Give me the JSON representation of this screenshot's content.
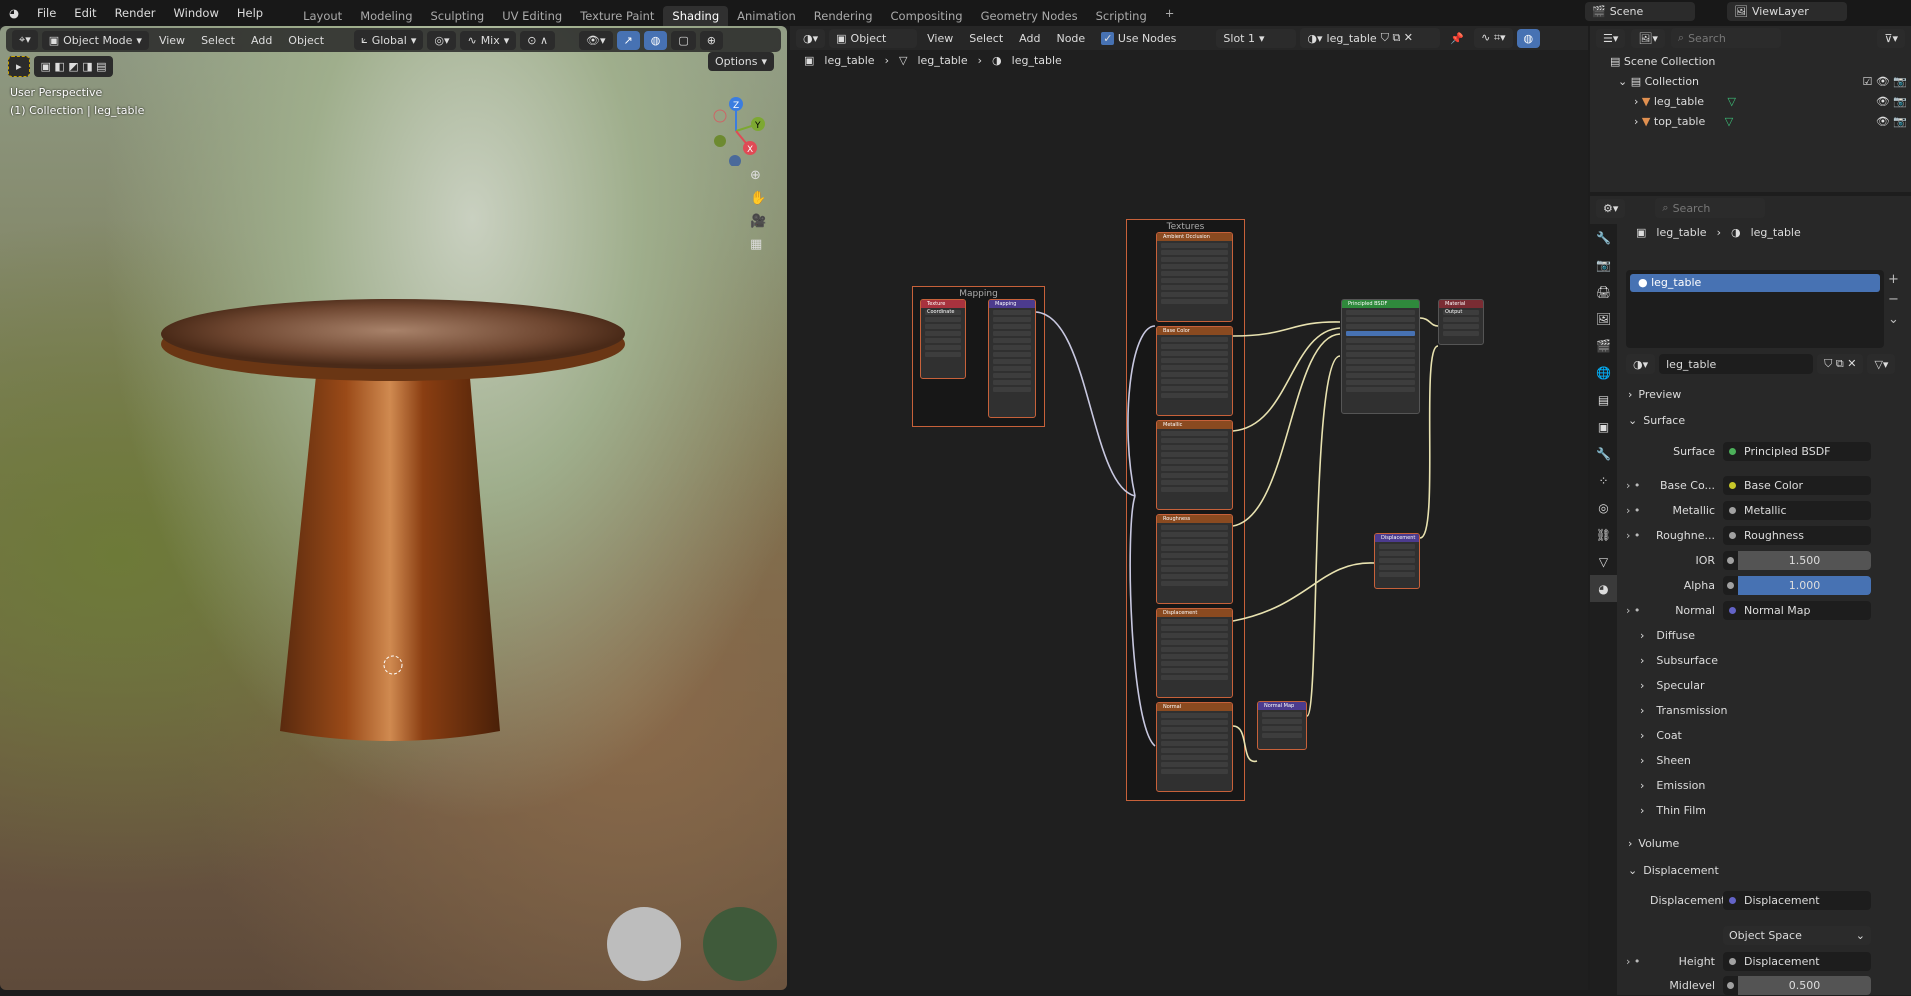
{
  "menu": [
    "File",
    "Edit",
    "Render",
    "Window",
    "Help"
  ],
  "workspaces": [
    "Layout",
    "Modeling",
    "Sculpting",
    "UV Editing",
    "Texture Paint",
    "Shading",
    "Animation",
    "Rendering",
    "Compositing",
    "Geometry Nodes",
    "Scripting"
  ],
  "active_workspace": "Shading",
  "scene": "Scene",
  "view_layer": "ViewLayer",
  "viewport": {
    "mode": "Object Mode",
    "menus": [
      "View",
      "Select",
      "Add",
      "Object"
    ],
    "orientation": "Global",
    "pivot": "Mix",
    "options": "Options",
    "overlay1": "User Perspective",
    "overlay2": "(1) Collection | leg_table",
    "axes": [
      "X",
      "Y",
      "Z"
    ]
  },
  "node_editor": {
    "type": "Object",
    "menus": [
      "View",
      "Select",
      "Add",
      "Node"
    ],
    "use_nodes": "Use Nodes",
    "slot": "Slot 1",
    "material": "leg_table",
    "breadcrumb": [
      "leg_table",
      "leg_table",
      "leg_table"
    ],
    "frames": {
      "mapping": "Mapping",
      "textures": "Textures"
    },
    "nodes": {
      "texcoord": "Texture Coordinate",
      "mapping": "Mapping",
      "textures": [
        "Ambient Occlusion",
        "Base Color",
        "Metallic",
        "Roughness",
        "Displacement",
        "Normal"
      ],
      "bsdf": "Principled BSDF",
      "output": "Material Output",
      "displacement": "Displacement",
      "normal_map": "Normal Map"
    }
  },
  "outliner": {
    "search_placeholder": "Search",
    "items": [
      "Scene Collection",
      "Collection",
      "leg_table",
      "top_table"
    ]
  },
  "properties": {
    "search_placeholder": "Search",
    "breadcrumb": [
      "leg_table",
      "leg_table"
    ],
    "slot_item": "leg_table",
    "material_name": "leg_table",
    "preview": "Preview",
    "surface_section": "Surface",
    "rows": [
      {
        "label": "Surface",
        "value": "Principled BSDF",
        "dot": "#4cb05a"
      },
      {
        "label": "Base Co...",
        "value": "Base Color",
        "dot": "#c7c729",
        "expand": true
      },
      {
        "label": "Metallic",
        "value": "Metallic",
        "dot": "#a1a1a1",
        "expand": true
      },
      {
        "label": "Roughne...",
        "value": "Roughness",
        "dot": "#a1a1a1",
        "expand": true
      },
      {
        "label": "IOR",
        "value": "1.500",
        "dot": "#a1a1a1",
        "num": true
      },
      {
        "label": "Alpha",
        "value": "1.000",
        "dot": "#a1a1a1",
        "num": true,
        "blue": true
      },
      {
        "label": "Normal",
        "value": "Normal Map",
        "dot": "#6363c7",
        "expand": true
      }
    ],
    "subpanels": [
      "Diffuse",
      "Subsurface",
      "Specular",
      "Transmission",
      "Coat",
      "Sheen",
      "Emission",
      "Thin Film"
    ],
    "volume": "Volume",
    "displacement_section": "Displacement",
    "disp_rows": [
      {
        "label": "Displacement",
        "value": "Displacement",
        "dot": "#6363c7"
      },
      {
        "label": "",
        "value": "Object Space",
        "select": true
      },
      {
        "label": "Height",
        "value": "Displacement",
        "dot": "#a1a1a1",
        "expand": true
      },
      {
        "label": "Midlevel",
        "value": "0.500",
        "dot": "#a1a1a1",
        "num": true
      }
    ]
  }
}
